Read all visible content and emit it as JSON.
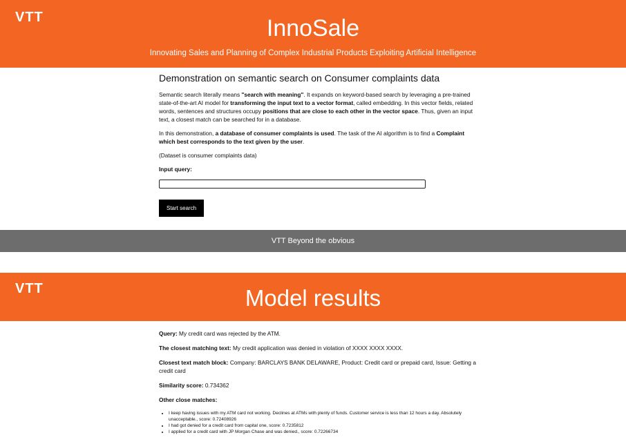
{
  "header": {
    "logo": "VTT",
    "title": "InnoSale",
    "subtitle": "Innovating Sales and Planning of Complex Industrial Products Exploiting Artificial Intelligence"
  },
  "demo": {
    "heading": "Demonstration on semantic search on Consumer complaints data",
    "p1": {
      "a": "Semantic search literally means ",
      "b": "\"search with meaning\"",
      "c": ". It expands on keyword-based search by leveraging a pre-trained state-of-the-art AI model for ",
      "d": "transforming the input text to a vector format",
      "e": ", called embedding. In this vector fields, related words, sentences and structures occupy ",
      "f": "positions that are close to each other in the vector space",
      "g": ". Thus, given an input text, a closest match can be searched for in a database."
    },
    "p2": {
      "a": "In this demonstration, ",
      "b": "a database of consumer complaints is used",
      "c": ". The task of the AI algorithm is to find a ",
      "d": "Complaint which best corresponds to the text given by the user",
      "e": "."
    },
    "dataset_note": "(Dataset is consumer complaints data)",
    "input_label": "Input query:",
    "input_value": "",
    "button_label": "Start search"
  },
  "footer": {
    "text": "VTT Beyond the obvious"
  },
  "results_header": {
    "logo": "VTT",
    "title": "Model results"
  },
  "results": {
    "query_label": "Query:",
    "query_value": " My credit card was rejected by the ATM.",
    "closest_label": "The closest matching text:",
    "closest_value": " My credit application was denied in violation of XXXX XXXX XXXX.",
    "block_label": "Closest text match block:",
    "block_value": " Company: BARCLAYS BANK DELAWARE, Product: Credit card or prepaid card, Issue: Getting a credit card",
    "score_label": "Similarity score:",
    "score_value": " 0.734362",
    "other_label": "Other close matches:",
    "other_matches": [
      "I keep having issues with my ATM card not working. Declines at ATMs with plenty of funds. Customer service is less than 12 hours a day. Absolutely unacceptable., score: 0.72408926",
      "I had got denied for a credit card from capital one, score: 0.7235812",
      "I applied for a credit card with JP Morgan Chase and was denied., score: 0.72266734"
    ]
  }
}
